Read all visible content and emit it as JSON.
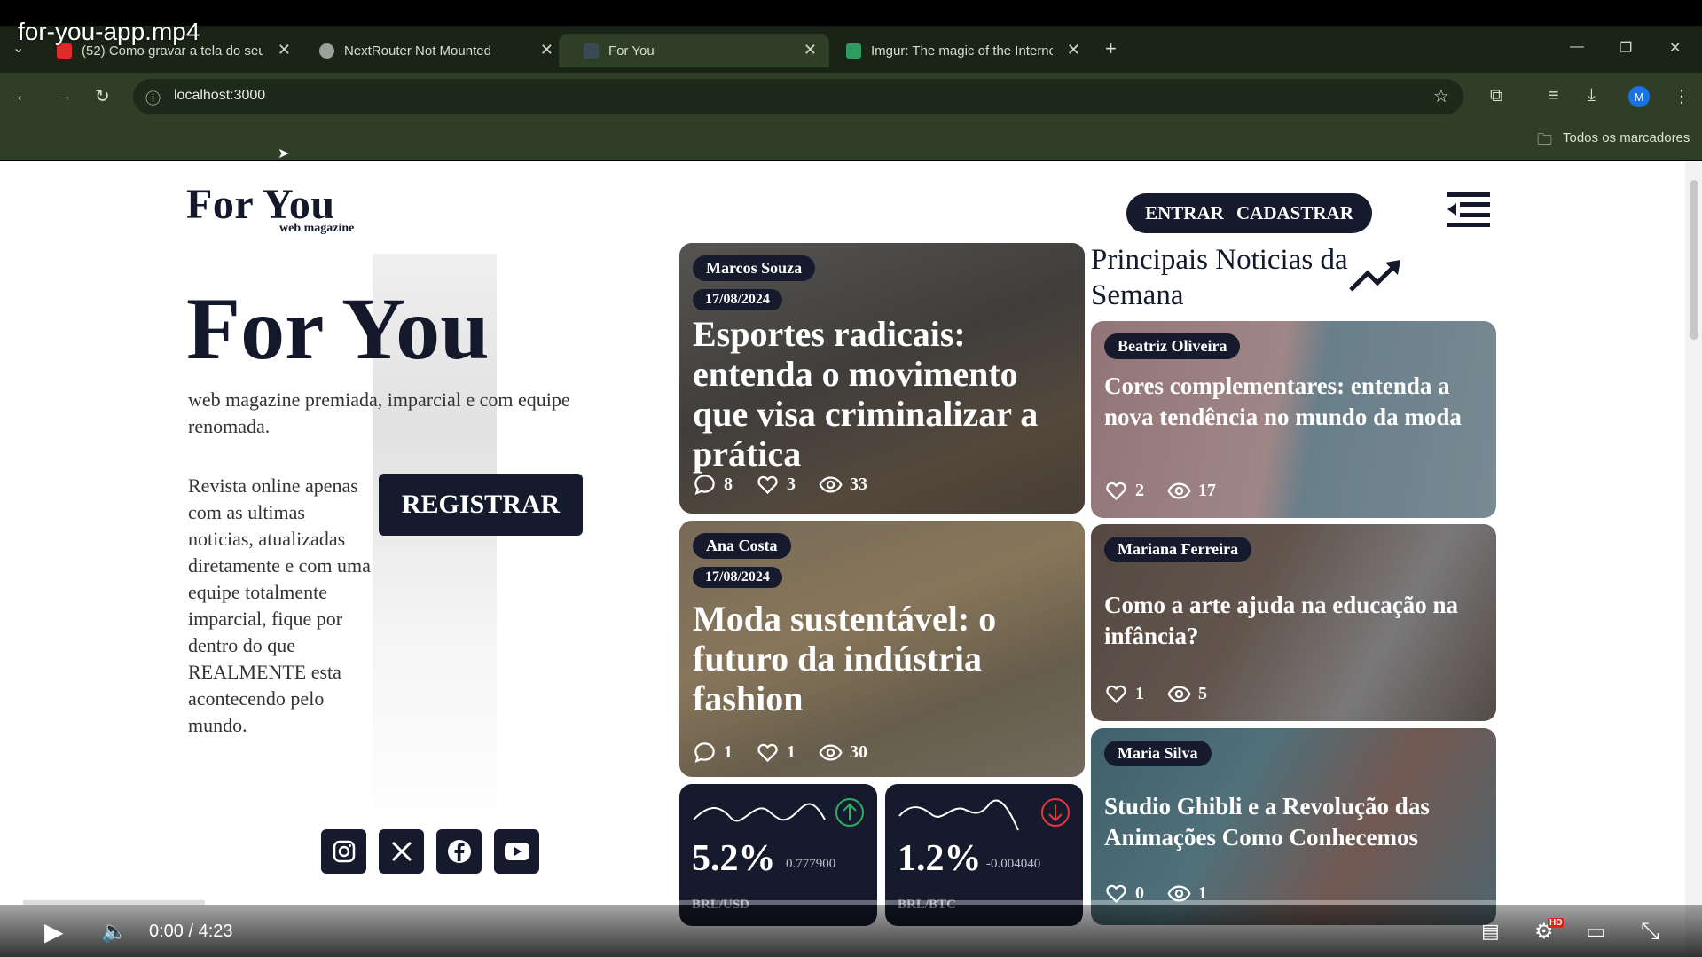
{
  "video": {
    "title": "for-you-app.mp4",
    "time": "0:00 / 4:23",
    "progress": 0.11
  },
  "browser": {
    "tabs": [
      {
        "label": "(52) Como gravar a tela do seu",
        "favicon_color": "#e02b2b"
      },
      {
        "label": "NextRouter Not Mounted",
        "favicon_color": "#9aa39a"
      },
      {
        "label": "For You",
        "favicon_color": "#3a4a55"
      },
      {
        "label": "Imgur: The magic of the Interne",
        "favicon_color": "#2e9b5f"
      }
    ],
    "active_tab": 2,
    "url": "localhost:3000",
    "bookmarks_label": "Todos os marcadores",
    "profile_initial": "M"
  },
  "site": {
    "logo": "For You",
    "logo_sub": "web magazine",
    "login": "ENTRAR",
    "signup": "CADASTRAR",
    "hero_title": "For You",
    "hero_tagline": "web magazine premiada, imparcial e com equipe renomada.",
    "hero_description": "Revista online apenas com as ultimas noticias, atualizadas diretamente e com uma equipe totalmente imparcial, fique por dentro do que REALMENTE esta acontecendo pelo mundo.",
    "register": "REGISTRAR",
    "section_title": "Principais Noticias da Semana"
  },
  "featured": [
    {
      "author": "Marcos Souza",
      "date": "17/08/2024",
      "title": "Esportes radicais: entenda o movimento que visa criminalizar a prática",
      "comments": "8",
      "likes": "3",
      "views": "33"
    },
    {
      "author": "Ana Costa",
      "date": "17/08/2024",
      "title": "Moda sustentável: o futuro da indústria fashion",
      "comments": "1",
      "likes": "1",
      "views": "30"
    }
  ],
  "top_news": [
    {
      "author": "Beatriz Oliveira",
      "title": "Cores complementares: entenda a nova tendência no mundo da moda",
      "likes": "2",
      "views": "17"
    },
    {
      "author": "Mariana Ferreira",
      "title": "Como a arte ajuda na educação na infância?",
      "likes": "1",
      "views": "5"
    },
    {
      "author": "Maria Silva",
      "title": "Studio Ghibli e a Revolução das Animações Como Conhecemos",
      "likes": "0",
      "views": "1"
    }
  ],
  "quotes": [
    {
      "pct": "5.2%",
      "change": "0.777900",
      "pair": "BRL/USD",
      "direction": "up",
      "color": "#2fae63"
    },
    {
      "pct": "1.2%",
      "change": "-0.004040",
      "pair": "BRL/BTC",
      "direction": "down",
      "color": "#e0383b"
    }
  ]
}
